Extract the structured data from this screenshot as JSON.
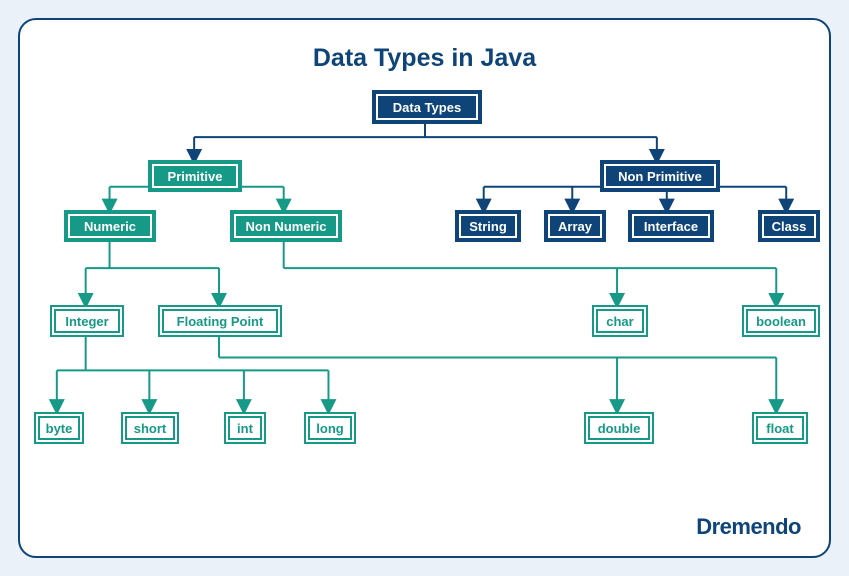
{
  "title": "Data Types in Java",
  "brand": "Dremendo",
  "nodes": {
    "root": "Data Types",
    "primitive": "Primitive",
    "nonPrimitive": "Non Primitive",
    "numeric": "Numeric",
    "nonNumeric": "Non Numeric",
    "string": "String",
    "array": "Array",
    "interface": "Interface",
    "class": "Class",
    "integer": "Integer",
    "floating": "Floating Point",
    "char": "char",
    "boolean": "boolean",
    "byte": "byte",
    "short": "short",
    "int": "int",
    "long": "long",
    "double": "double",
    "float": "float"
  },
  "chart_data": {
    "type": "tree",
    "title": "Data Types in Java",
    "root": {
      "label": "Data Types",
      "color": "blue",
      "children": [
        {
          "label": "Primitive",
          "color": "teal-filled",
          "children": [
            {
              "label": "Numeric",
              "color": "teal-filled",
              "children": [
                {
                  "label": "Integer",
                  "color": "teal-outline",
                  "children": [
                    {
                      "label": "byte",
                      "color": "teal-outline"
                    },
                    {
                      "label": "short",
                      "color": "teal-outline"
                    },
                    {
                      "label": "int",
                      "color": "teal-outline"
                    },
                    {
                      "label": "long",
                      "color": "teal-outline"
                    }
                  ]
                },
                {
                  "label": "Floating Point",
                  "color": "teal-outline",
                  "children": [
                    {
                      "label": "double",
                      "color": "teal-outline"
                    },
                    {
                      "label": "float",
                      "color": "teal-outline"
                    }
                  ]
                }
              ]
            },
            {
              "label": "Non Numeric",
              "color": "teal-filled",
              "children": [
                {
                  "label": "char",
                  "color": "teal-outline"
                },
                {
                  "label": "boolean",
                  "color": "teal-outline"
                }
              ]
            }
          ]
        },
        {
          "label": "Non Primitive",
          "color": "blue",
          "children": [
            {
              "label": "String",
              "color": "blue"
            },
            {
              "label": "Array",
              "color": "blue"
            },
            {
              "label": "Interface",
              "color": "blue"
            },
            {
              "label": "Class",
              "color": "blue"
            }
          ]
        }
      ]
    }
  }
}
